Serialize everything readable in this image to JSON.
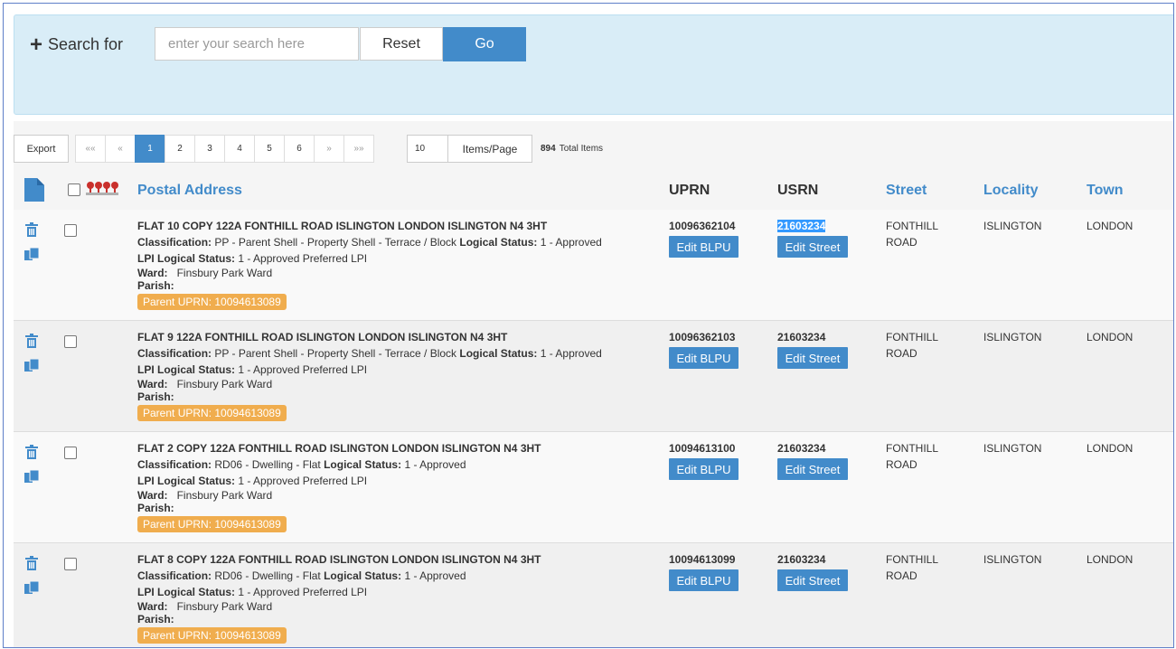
{
  "search": {
    "label": "Search for",
    "placeholder": "enter your search here",
    "reset_label": "Reset",
    "go_label": "Go"
  },
  "toolbar": {
    "export_label": "Export",
    "pager": [
      "««",
      "«",
      "1",
      "2",
      "3",
      "4",
      "5",
      "6",
      "»",
      "»»"
    ],
    "active_page": "1",
    "items_per_page": "10",
    "items_per_page_label": "Items/Page",
    "total_count": "894",
    "total_label": "Total Items"
  },
  "columns": {
    "postal_address": "Postal Address",
    "uprn": "UPRN",
    "usrn": "USRN",
    "street": "Street",
    "locality": "Locality",
    "town": "Town"
  },
  "labels": {
    "classification": "Classification:",
    "logical_status": "Logical Status:",
    "lpi_logical_status": "LPI Logical Status:",
    "ward": "Ward:",
    "parish": "Parish:",
    "edit_blpu": "Edit BLPU",
    "edit_street": "Edit Street"
  },
  "rows": [
    {
      "address": "FLAT 10 COPY 122A FONTHILL ROAD ISLINGTON LONDON ISLINGTON N4 3HT",
      "classification": "PP - Parent Shell - Property Shell - Terrace / Block",
      "logical_status": "1 - Approved",
      "lpi_status": "1 - Approved Preferred LPI",
      "ward": "Finsbury Park Ward",
      "parent_uprn": "Parent UPRN: 10094613089",
      "uprn": "10096362104",
      "usrn": "21603234",
      "street_1": "FONTHILL",
      "street_2": "ROAD",
      "locality": "ISLINGTON",
      "town": "LONDON"
    },
    {
      "address": "FLAT 9 122A FONTHILL ROAD ISLINGTON LONDON ISLINGTON N4 3HT",
      "classification": "PP - Parent Shell - Property Shell - Terrace / Block",
      "logical_status": "1 - Approved",
      "lpi_status": "1 - Approved Preferred LPI",
      "ward": "Finsbury Park Ward",
      "parent_uprn": "Parent UPRN: 10094613089",
      "uprn": "10096362103",
      "usrn": "21603234",
      "street_1": "FONTHILL",
      "street_2": "ROAD",
      "locality": "ISLINGTON",
      "town": "LONDON"
    },
    {
      "address": "FLAT 2 COPY 122A FONTHILL ROAD ISLINGTON LONDON ISLINGTON N4 3HT",
      "classification": "RD06 - Dwelling - Flat",
      "logical_status": "1 - Approved",
      "lpi_status": "1 - Approved Preferred LPI",
      "ward": "Finsbury Park Ward",
      "parent_uprn": "Parent UPRN: 10094613089",
      "uprn": "10094613100",
      "usrn": "21603234",
      "street_1": "FONTHILL",
      "street_2": "ROAD",
      "locality": "ISLINGTON",
      "town": "LONDON"
    },
    {
      "address": "FLAT 8 COPY 122A FONTHILL ROAD ISLINGTON LONDON ISLINGTON N4 3HT",
      "classification": "RD06 - Dwelling - Flat",
      "logical_status": "1 - Approved",
      "lpi_status": "1 - Approved Preferred LPI",
      "ward": "Finsbury Park Ward",
      "parent_uprn": "Parent UPRN: 10094613089",
      "uprn": "10094613099",
      "usrn": "21603234",
      "street_1": "FONTHILL",
      "street_2": "ROAD",
      "locality": "ISLINGTON",
      "town": "LONDON"
    }
  ],
  "colors": {
    "primary": "#428bca",
    "badge": "#f0ad4e",
    "panel": "#d9edf7",
    "selection": "#3399ff"
  }
}
